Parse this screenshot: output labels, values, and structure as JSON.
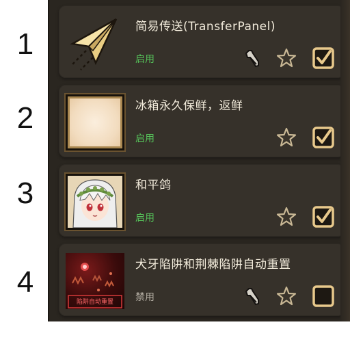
{
  "annotations": [
    "1",
    "2",
    "3",
    "4"
  ],
  "mods": [
    {
      "title": "简易传送(TransferPanel)",
      "status": "启用",
      "enabled": true,
      "has_config": true,
      "thumbnail": "paper-plane-icon"
    },
    {
      "title": "冰箱永久保鲜，返鲜",
      "status": "启用",
      "enabled": true,
      "has_config": false,
      "thumbnail": "blank-parchment"
    },
    {
      "title": "和平鸽",
      "status": "启用",
      "enabled": true,
      "has_config": false,
      "thumbnail": "anime-girl-portrait"
    },
    {
      "title": "犬牙陷阱和荆棘陷阱自动重置",
      "status": "禁用",
      "enabled": false,
      "has_config": true,
      "thumbnail": "trap-scene",
      "thumbnail_caption": "陷阱自动重置"
    }
  ],
  "colors": {
    "panel_bg": "#2a2620",
    "row_bg": "#36312a",
    "title": "#f3ecdc",
    "status_enabled": "#56c45a",
    "status_disabled": "#b7b1a6",
    "icon_tan": "#e8c98c"
  }
}
